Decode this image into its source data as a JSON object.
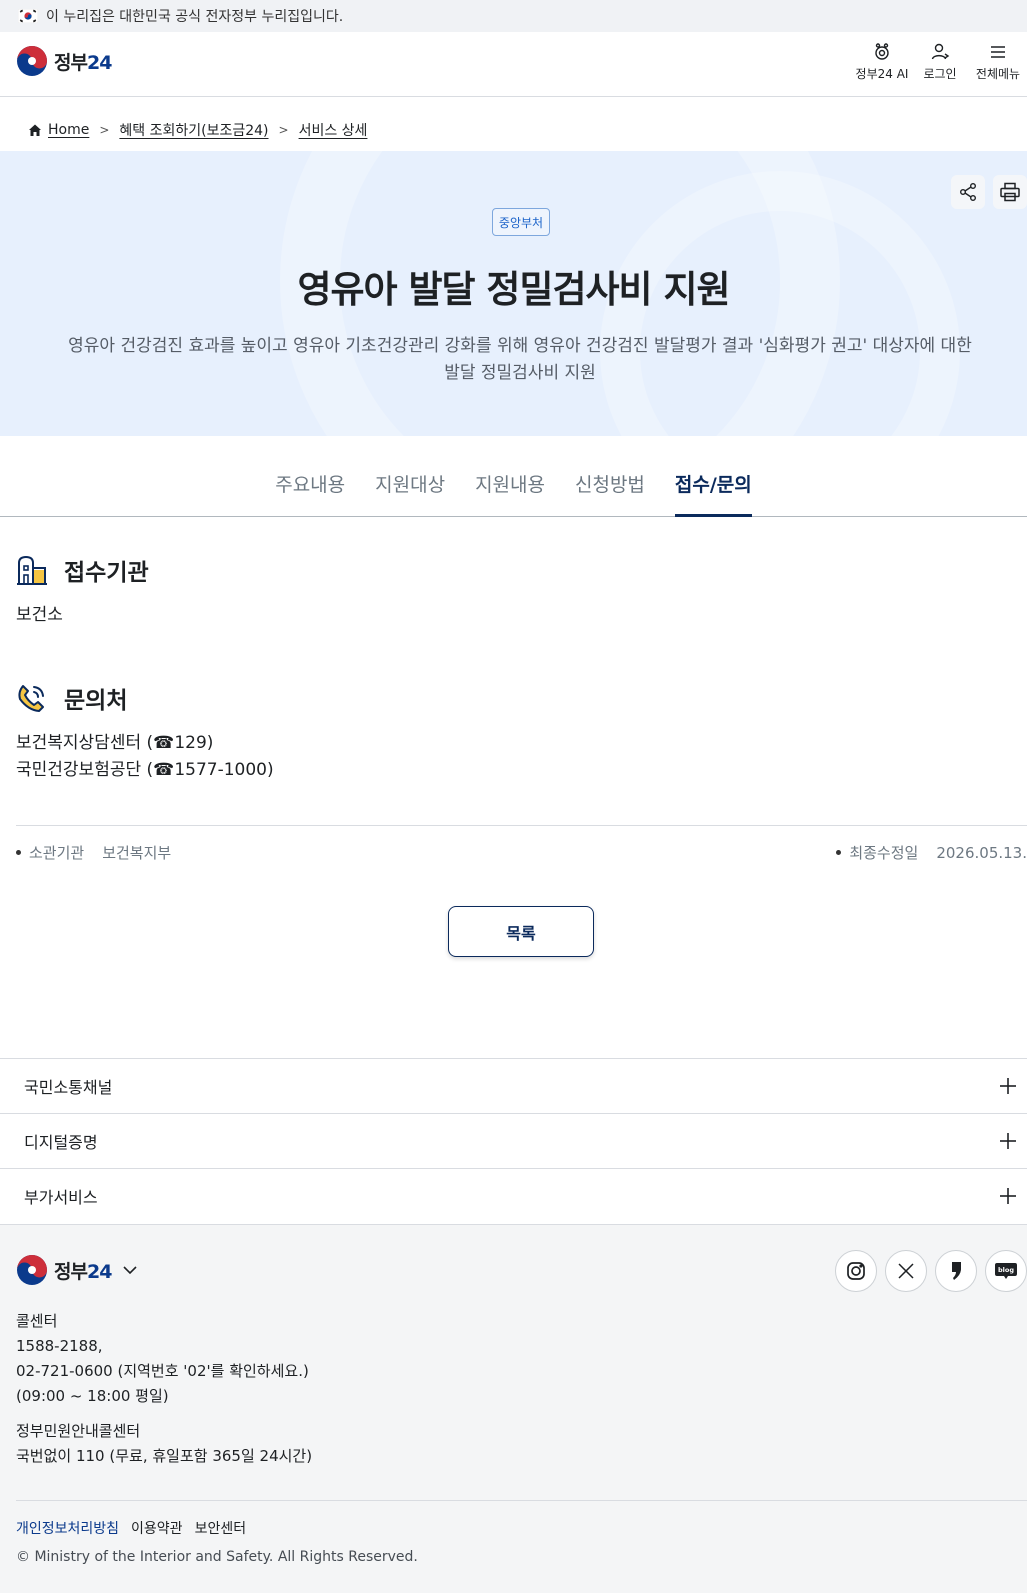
{
  "gov_bar": {
    "text": "이 누리집은 대한민국 공식 전자정부 누리집입니다."
  },
  "header": {
    "logo_word": "정부",
    "logo_num": "24",
    "actions": [
      {
        "label": "정부24 AI",
        "icon": "ai-robot-icon"
      },
      {
        "label": "로그인",
        "icon": "user-icon"
      },
      {
        "label": "전체메뉴",
        "icon": "hamburger-menu-icon"
      }
    ]
  },
  "breadcrumb": {
    "items": [
      "Home",
      "혜택 조회하기(보조금24)",
      "서비스 상세"
    ]
  },
  "hero": {
    "badge": "중앙부처",
    "title": "영유아 발달 정밀검사비 지원",
    "description": "영유아 건강검진 효과를 높이고 영유아 기초건강관리 강화를 위해 영유아 건강검진 발달평가 결과 '심화평가 권고' 대상자에 대한 발달 정밀검사비 지원"
  },
  "tabs": [
    {
      "label": "주요내용",
      "active": false
    },
    {
      "label": "지원대상",
      "active": false
    },
    {
      "label": "지원내용",
      "active": false
    },
    {
      "label": "신청방법",
      "active": false
    },
    {
      "label": "접수/문의",
      "active": true
    }
  ],
  "reception": {
    "title": "접수기관",
    "body": "보건소"
  },
  "contact": {
    "title": "문의처",
    "lines": [
      "보건복지상담센터 (☎129)",
      "국민건강보험공단 (☎1577-1000)"
    ]
  },
  "meta": {
    "dept_label": "소관기관",
    "dept_value": "보건복지부",
    "updated_label": "최종수정일",
    "updated_value": "2026.05.13."
  },
  "list_button": "목록",
  "accordions": [
    "국민소통채널",
    "디지털증명",
    "부가서비스"
  ],
  "footer": {
    "call_center_title": "콜센터",
    "call_center_lines": [
      "1588-2188,",
      "02-721-0600 (지역번호 '02'를 확인하세요.)",
      "(09:00 ~ 18:00 평일)"
    ],
    "civil_title": "정부민원안내콜센터",
    "civil_line": "국번없이 110 (무료, 휴일포함 365일 24시간)",
    "links": [
      "개인정보처리방침",
      "이용약관",
      "보안센터"
    ],
    "copyright": "© Ministry of the Interior and Safety. All Rights Reserved.",
    "socials": [
      "instagram-icon",
      "x-twitter-icon",
      "kakao-story-icon",
      "blog-icon"
    ],
    "blog_label": "blog"
  }
}
